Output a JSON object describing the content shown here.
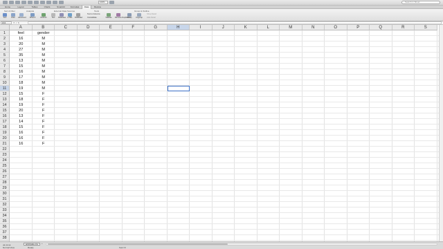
{
  "toolbar": {
    "zoom": "100%",
    "search_placeholder": "Search in Sheet"
  },
  "ribbon_tabs": [
    "Home",
    "Layout",
    "Tables",
    "Charts",
    "SmartArt",
    "Formulas",
    "Data",
    "Review"
  ],
  "ribbon_active_tab": "Data",
  "ribbon": {
    "groups": [
      "Sort & Filter",
      "Analysis",
      "External Data Sources",
      "Tools",
      "Group & Outline"
    ],
    "buttons": [
      "Sort",
      "Filter",
      "Advanced",
      "What-If",
      "Refresh",
      "Text",
      "Database",
      "HTML",
      "FileMaker",
      "Validate",
      "Remove Duplicates",
      "Group",
      "Ungroup"
    ],
    "small": [
      "Text to Columns",
      "Consolidate",
      "Show Detail",
      "Hide Detail"
    ]
  },
  "formula_bar": {
    "name_box": "H11",
    "fx_icons": "✕ ✓ fx",
    "formula": ""
  },
  "columns": [
    "A",
    "B",
    "C",
    "D",
    "E",
    "F",
    "G",
    "H",
    "I",
    "J",
    "K",
    "L",
    "M",
    "N",
    "O",
    "P",
    "Q",
    "R",
    "S"
  ],
  "selected_column": "H",
  "selected_row": 11,
  "row_count": 41,
  "table": {
    "headers": [
      "feel",
      "gender"
    ],
    "rows": [
      [
        "16",
        "M"
      ],
      [
        "20",
        "M"
      ],
      [
        "27",
        "M"
      ],
      [
        "35",
        "M"
      ],
      [
        "13",
        "M"
      ],
      [
        "15",
        "M"
      ],
      [
        "16",
        "M"
      ],
      [
        "17",
        "M"
      ],
      [
        "18",
        "M"
      ],
      [
        "19",
        "M"
      ],
      [
        "15",
        "F"
      ],
      [
        "18",
        "F"
      ],
      [
        "19",
        "F"
      ],
      [
        "20",
        "F"
      ],
      [
        "13",
        "F"
      ],
      [
        "14",
        "F"
      ],
      [
        "15",
        "F"
      ],
      [
        "16",
        "F"
      ],
      [
        "16",
        "F"
      ],
      [
        "16",
        "F"
      ]
    ]
  },
  "sheet": {
    "tab_name": "anticipate.csv",
    "nav": "◂◂ ◂ ▸ ▸▸",
    "add": "+"
  },
  "status_bar": {
    "view": "Normal View",
    "mode": "Ready",
    "sum": "Sum=0"
  },
  "colors": {
    "accent": "#3a6fc6",
    "selected_header": "#c8d6ea"
  }
}
